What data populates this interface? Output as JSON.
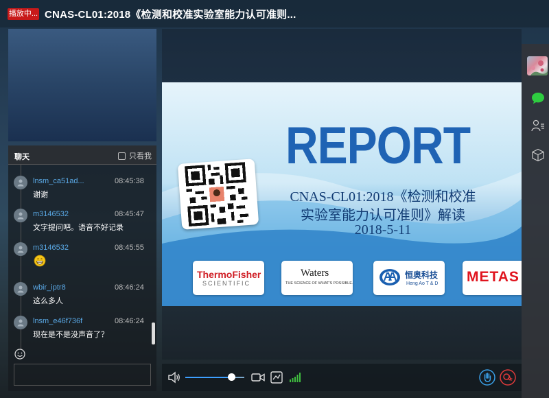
{
  "header": {
    "live_badge": "播放中...",
    "title": "CNAS-CL01:2018《检测和校准实验室能力认可准则..."
  },
  "chat": {
    "tab_label": "聊天",
    "only_me_label": "只看我",
    "input_placeholder": "",
    "messages": [
      {
        "user": "lnsm_ca51ad...",
        "time": "08:45:38",
        "text": "谢谢"
      },
      {
        "user": "m3146532",
        "time": "08:45:47",
        "text": "文字提问吧。语音不好记录"
      },
      {
        "user": "m3146532",
        "time": "08:45:55",
        "text": "",
        "emoji": "grinning-face"
      },
      {
        "user": "wbir_iptr8",
        "time": "08:46:24",
        "text": "这么多人"
      },
      {
        "user": "lnsm_e46f736f",
        "time": "08:46:24",
        "text": "现在是不是没声音了？"
      }
    ]
  },
  "slide": {
    "headline": "REPORT",
    "line1": "CNAS-CL01:2018《检测和校准",
    "line2": "实验室能力认可准则》解读",
    "line3": "2018-5-11",
    "logos": {
      "thermo_main": "ThermoFisher",
      "thermo_sub": "SCIENTIFIC",
      "waters_main": "Waters",
      "waters_sub": "THE SCIENCE OF WHAT'S POSSIBLE.",
      "hengao_main": "恒奥科技",
      "hengao_sub": "Heng Ao T & D",
      "metas_main": "METAS"
    }
  },
  "controls": {
    "volume_level": 0.78
  },
  "colors": {
    "live_badge": "#c81a1a",
    "username": "#5aa9e6",
    "slide_headline": "#1f63b4",
    "chat_icon": "#2ecc40"
  }
}
